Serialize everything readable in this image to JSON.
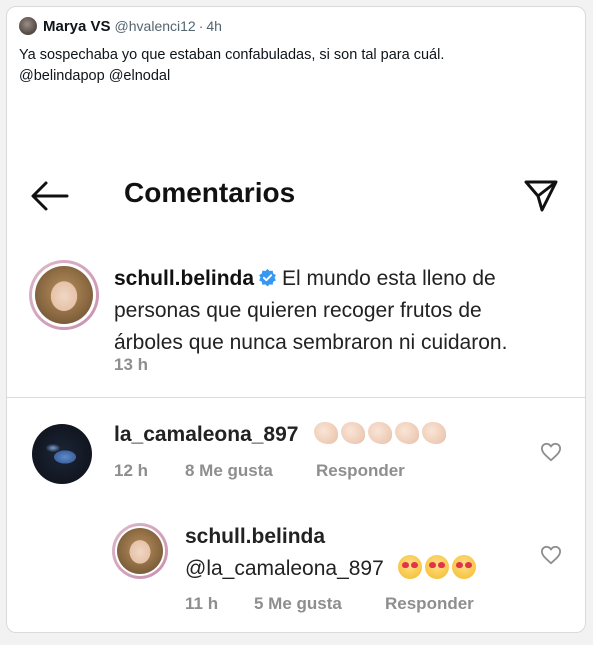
{
  "tweet": {
    "author_name": "Marya VS",
    "author_handle": "@hvalenci12",
    "separator": "·",
    "time": "4h",
    "text_line1": "Ya sospechaba yo que estaban confabuladas, si son tal para cuál.",
    "text_line2": "@belindapop @elnodal"
  },
  "instagram": {
    "header_title": "Comentarios",
    "main_comment": {
      "username": "schull.belinda",
      "text_line1": "El mundo esta lleno de",
      "text_line2": "personas que quieren recoger frutos de",
      "text_line3": "árboles que nunca sembraron ni cuidaron.",
      "time": "13 h"
    },
    "replies": [
      {
        "username": "la_camaleona_897",
        "time": "12 h",
        "likes": "8 Me gusta",
        "reply_label": "Responder"
      },
      {
        "username": "schull.belinda",
        "text": "@la_camaleona_897",
        "time": "11 h",
        "likes": "5 Me gusta",
        "reply_label": "Responder"
      }
    ]
  },
  "colors": {
    "meta_gray": "#8e8e8e",
    "verified_blue": "#3897f0",
    "twitter_gray": "#536471"
  }
}
